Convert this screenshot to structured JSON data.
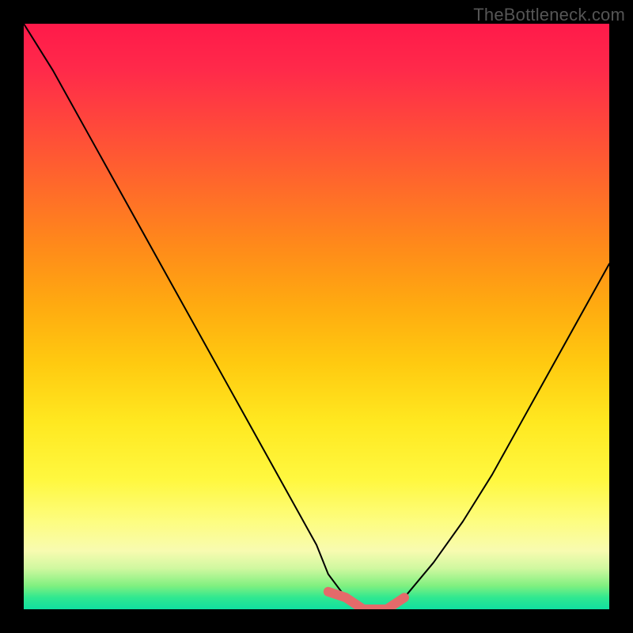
{
  "watermark": "TheBottleneck.com",
  "chart_data": {
    "type": "line",
    "title": "",
    "xlabel": "",
    "ylabel": "",
    "xlim": [
      0,
      100
    ],
    "ylim": [
      0,
      100
    ],
    "x": [
      0,
      5,
      10,
      15,
      20,
      25,
      30,
      35,
      40,
      45,
      50,
      52,
      55,
      58,
      60,
      62,
      65,
      70,
      75,
      80,
      85,
      90,
      95,
      100
    ],
    "values": [
      100,
      92,
      83,
      74,
      65,
      56,
      47,
      38,
      29,
      20,
      11,
      6,
      2,
      0,
      0,
      0,
      2,
      8,
      15,
      23,
      32,
      41,
      50,
      59
    ],
    "highlight_range_x": [
      51,
      65
    ],
    "background_gradient": {
      "top_color": "#ff1a4a",
      "bottom_color": "#10e0a0"
    }
  }
}
